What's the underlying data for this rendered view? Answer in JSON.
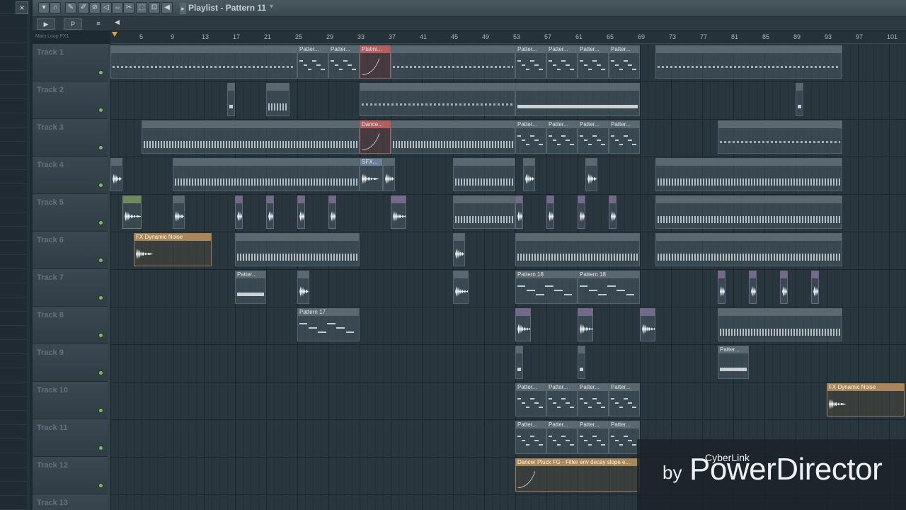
{
  "window": {
    "close_icon": "×",
    "title": "Playlist - Pattern 11",
    "title_arrow": "▸",
    "title_caret": "▾"
  },
  "toolbar": {
    "icons": [
      "menu-arrow-icon",
      "magnet-icon",
      "draw-icon",
      "paint-icon",
      "delete-icon",
      "mute-icon",
      "slip-icon",
      "slice-icon",
      "select-icon",
      "zoom-icon",
      "playback-icon"
    ]
  },
  "subbar": {
    "btn1": "▶",
    "btn2": "P",
    "btn3": "≡",
    "left_arrow": "◀",
    "ruler_label": "Main  Loop  FX1"
  },
  "ruler": {
    "bars": [
      "5",
      "9",
      "13",
      "17",
      "21",
      "25",
      "29",
      "33",
      "37",
      "41",
      "45",
      "49",
      "53",
      "57",
      "61",
      "65",
      "69",
      "73",
      "77",
      "81",
      "85",
      "89",
      "93",
      "97",
      "101"
    ]
  },
  "tracks": [
    {
      "name": "Track 1"
    },
    {
      "name": "Track 2"
    },
    {
      "name": "Track 3"
    },
    {
      "name": "Track 4"
    },
    {
      "name": "Track 5"
    },
    {
      "name": "Track 6"
    },
    {
      "name": "Track 7"
    },
    {
      "name": "Track 8"
    },
    {
      "name": "Track 9"
    },
    {
      "name": "Track 10"
    },
    {
      "name": "Track 11"
    },
    {
      "name": "Track 12"
    },
    {
      "name": "Track 13"
    }
  ],
  "clips": {
    "pattern": "Patter...",
    "platinum": "Platini...",
    "dance": "Dance...",
    "sfx": "SFX...",
    "fx_dynamic_noise": "FX Dynamic Noise",
    "pattern_18": "Pattern 18",
    "pattern_17": "Pattern 17",
    "dance_pluck": "Dancer Pluck FG - Filter env decay slope e..."
  },
  "watermark": {
    "small": "CyberLink",
    "by": "by",
    "big": "PowerDirector"
  }
}
